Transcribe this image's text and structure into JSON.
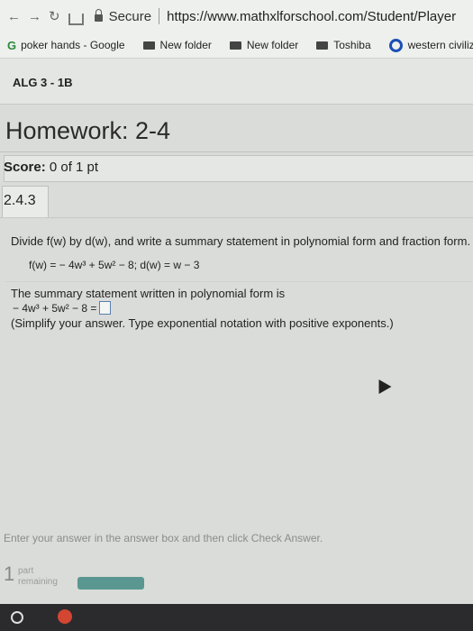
{
  "browser": {
    "secure_label": "Secure",
    "url": "https://www.mathxlforschool.com/Student/Player"
  },
  "bookmarks": [
    {
      "label": "poker hands - Google",
      "icon": "google-icon"
    },
    {
      "label": "New folder",
      "icon": "folder-icon"
    },
    {
      "label": "New folder",
      "icon": "folder-icon"
    },
    {
      "label": "Toshiba",
      "icon": "folder-icon"
    },
    {
      "label": "western civiliz",
      "icon": "q-icon"
    }
  ],
  "course": {
    "title": "ALG 3 - 1B"
  },
  "homework": {
    "title": "Homework: 2-4"
  },
  "score": {
    "label": "Score:",
    "value": "0 of 1 pt"
  },
  "question": {
    "number": "2.4.3",
    "instruction": "Divide f(w) by d(w), and write a summary statement in polynomial form and fraction form.",
    "given": "f(w) = − 4w³ + 5w² − 8; d(w) = w − 3",
    "statement": "The summary statement written in polynomial form is",
    "expression": "− 4w³ + 5w² − 8 =",
    "hint": "(Simplify your answer. Type exponential notation with positive exponents.)"
  },
  "footer": {
    "note": "Enter your answer in the answer box and then click Check Answer.",
    "parts_count": "1",
    "parts_label_1": "part",
    "parts_label_2": "remaining",
    "progress_fraction": 1.0
  }
}
